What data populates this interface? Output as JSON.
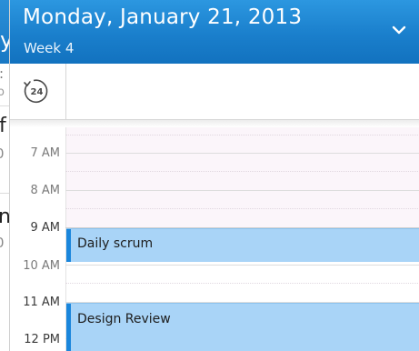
{
  "calendar": {
    "date_title": "Monday, January 21, 2013",
    "week_label": "Week 4",
    "time_format_badge": "24",
    "hours": [
      "7 AM",
      "8 AM",
      "9 AM",
      "10 AM",
      "11 AM",
      "12 PM"
    ],
    "events": [
      {
        "title": "Daily scrum"
      },
      {
        "title": "Design Review"
      }
    ]
  },
  "underlying": {
    "fragments": [
      "y",
      ":",
      "o",
      "f",
      "0",
      "n",
      "0"
    ]
  },
  "colors": {
    "header": "#1a7fcc",
    "event_fill": "#a9d4f7",
    "event_accent": "#1a86dc"
  },
  "icons": [
    "chevron-down-icon",
    "time-format-24h-icon"
  ]
}
